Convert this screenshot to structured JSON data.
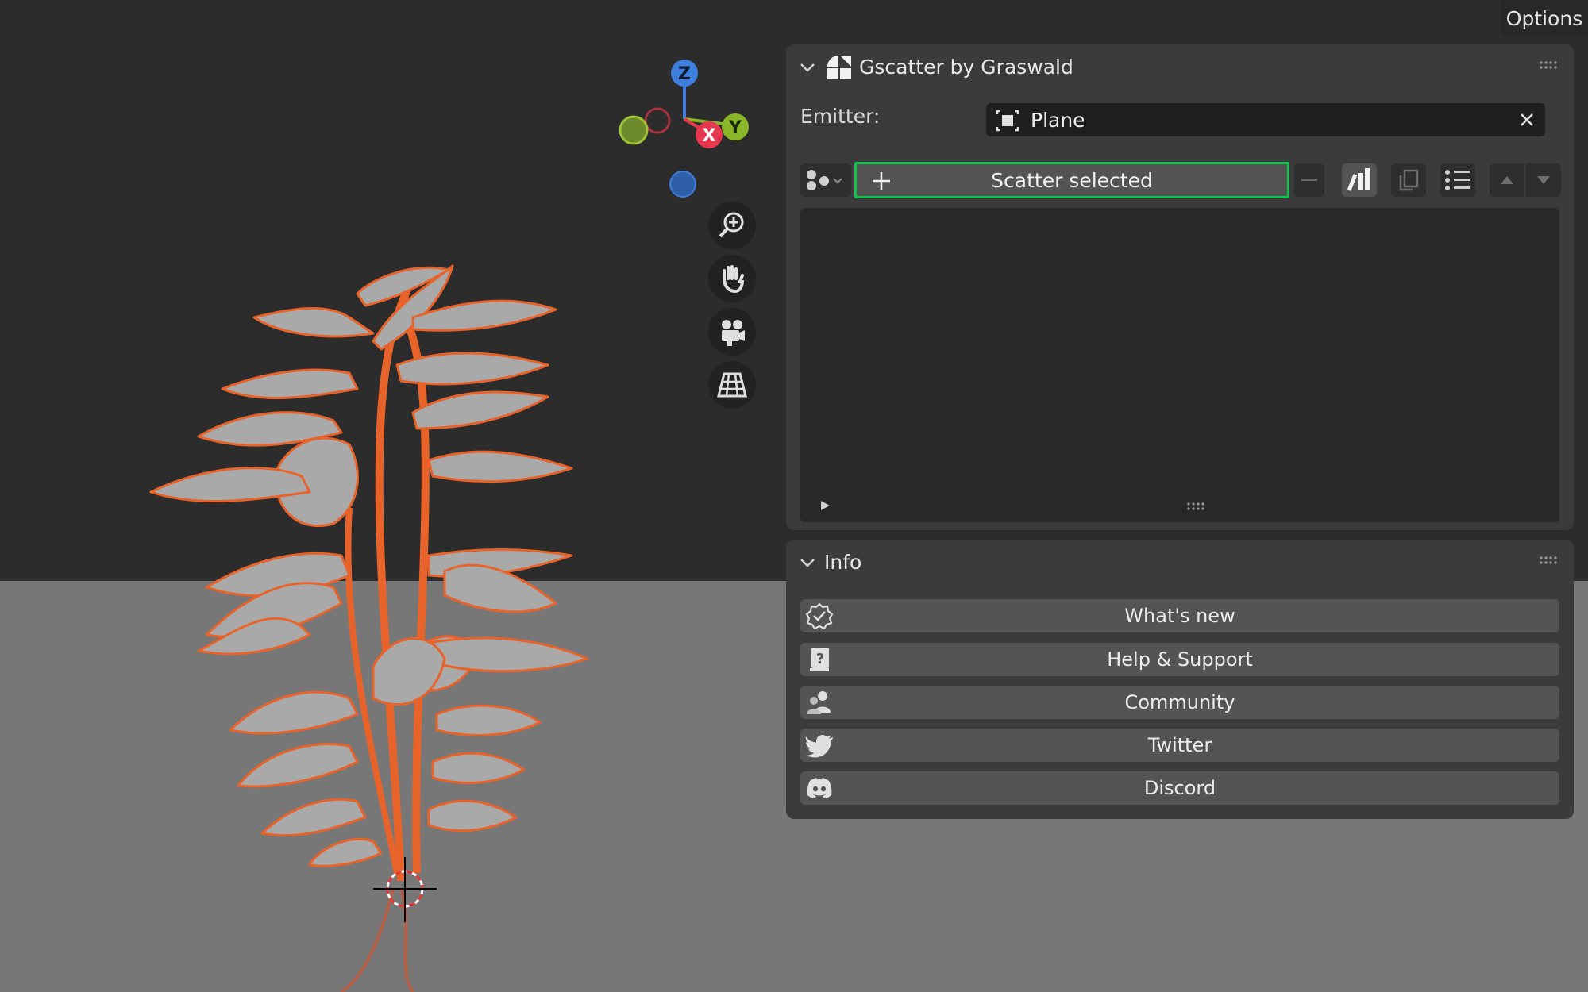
{
  "viewport": {
    "options_label": "Options",
    "gizmo": {
      "z": "Z",
      "y": "Y",
      "x": "X"
    },
    "nav_buttons": [
      "zoom-icon",
      "pan-hand-icon",
      "camera-icon",
      "grid-perspective-icon"
    ]
  },
  "gscatter_panel": {
    "title": "Gscatter by Graswald",
    "emitter_label": "Emitter:",
    "emitter_value": "Plane",
    "scatter_button_label": "Scatter selected",
    "highlight_color": "#13c24a"
  },
  "info_panel": {
    "title": "Info",
    "buttons": [
      {
        "label": "What's new",
        "icon": "badge-check-icon"
      },
      {
        "label": "Help & Support",
        "icon": "help-book-icon"
      },
      {
        "label": "Community",
        "icon": "community-icon"
      },
      {
        "label": "Twitter",
        "icon": "twitter-icon"
      },
      {
        "label": "Discord",
        "icon": "discord-icon"
      }
    ]
  },
  "colors": {
    "selection_outline": "#e8632a",
    "floor": "#777777",
    "background": "#2c2c2c"
  }
}
